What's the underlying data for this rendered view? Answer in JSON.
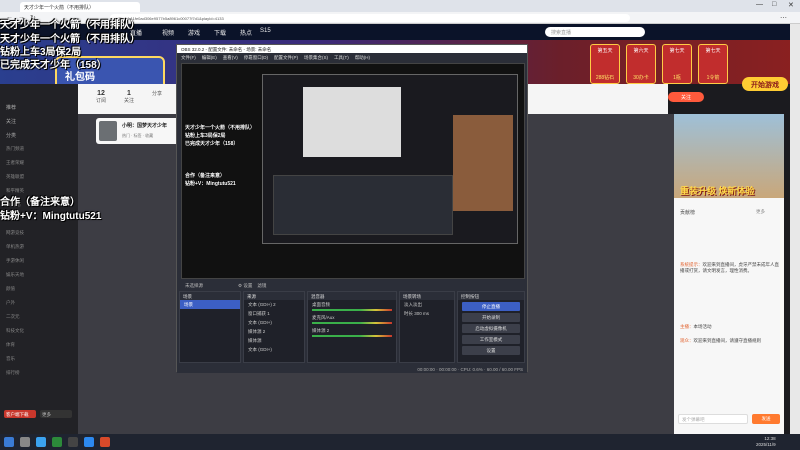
{
  "browser": {
    "tab_title": "天才少年一个火箭（不用排队）",
    "url": "e7beb4-11fe0ad306e9577b5a8961c00077f7d1&playId=4133",
    "window_controls": [
      "—",
      "□",
      "✕"
    ]
  },
  "site": {
    "nav": [
      "直播",
      "视频",
      "游戏",
      "下载",
      "热点",
      "S15"
    ],
    "search_placeholder": "搜索直播",
    "banner_promo": "礼包码",
    "days": [
      {
        "label": "第五天",
        "amount": "288钻石"
      },
      {
        "label": "第六天",
        "amount": "30办卡"
      },
      {
        "label": "第七天",
        "amount": "1瓶"
      },
      {
        "label": "第七天",
        "amount": "1令箭"
      }
    ],
    "play_button": "开始游戏"
  },
  "room": {
    "stats": [
      {
        "value": "12",
        "label": "订阅"
      },
      {
        "value": "1",
        "label": "关注"
      },
      {
        "value": "",
        "label": "分享"
      },
      {
        "value": "",
        "label": "消息"
      }
    ],
    "follow_label": "关注",
    "anchor_name": "小明：国梦天才少年",
    "anchor_tags": "热门 · 标签 · 收藏"
  },
  "sidebar": {
    "items": [
      "推荐",
      "关注",
      "分类",
      "热门频道",
      "王者荣耀",
      "英雄联盟",
      "和平精英",
      "CF手游",
      "原神",
      "网游竞技",
      "单机热游",
      "手游休闲",
      "娱乐天地",
      "颜值",
      "户外",
      "二次元",
      "科技文化",
      "体育",
      "音乐",
      "排行榜"
    ],
    "footer_btn1": "客户端下载",
    "footer_btn2": "更多"
  },
  "overlay": {
    "line1": "天才少年一个火箭（不用排队）",
    "line2": "钻粉上车3局保2局",
    "line3": "已完成天才少年（158）",
    "line4": "合作（备注来意）",
    "line5": "钻粉+V：Mingtutu521"
  },
  "obs": {
    "title": "OBS 32.0.2 - 配置文件: 未命名 - 场景: 未命名",
    "menu": [
      "文件(F)",
      "编辑(E)",
      "查看(V)",
      "停靠窗口(D)",
      "配置文件(P)",
      "场景集合(S)",
      "工具(T)",
      "帮助(H)"
    ],
    "toolbar_items": [
      "未选择源",
      "设置",
      "滤镜"
    ],
    "docks": {
      "scenes": {
        "title": "场景",
        "items": [
          "场景"
        ]
      },
      "sources": {
        "title": "来源",
        "items": [
          "文本 (GDI+) 2",
          "窗口捕获 1",
          "文本 (GDI+)",
          "媒体源 2",
          "媒体源",
          "文本 (GDI+)"
        ]
      },
      "mixer": {
        "title": "混音器",
        "items": [
          "桌面音频",
          "麦克风/Aux",
          "媒体源 2"
        ]
      },
      "transitions": {
        "title": "场景转场",
        "items": [
          "淡入淡出",
          "时长 300 ms"
        ]
      },
      "controls": {
        "title": "控制按钮",
        "buttons": [
          "停止直播",
          "开始录制",
          "启动虚拟摄像机",
          "工作室模式",
          "设置"
        ]
      }
    },
    "status": "00:00:00 · 00:00:00 · CPU: 0.6% · 60.00 / 60.00 FPS"
  },
  "right": {
    "game_ad": "重装升级 焕新体验",
    "rank_title": "贡献榜",
    "rank_link": "更多",
    "chat": [
      {
        "user": "系统提示：",
        "text": "欢迎来到直播间，虎牙严禁未成年人直播或打赏，请文明发言，理性消费。"
      },
      {
        "user": "主播：",
        "text": "本场活动"
      },
      {
        "user": "观众：",
        "text": "欢迎来到直播间，请遵守直播规则"
      }
    ],
    "chat_placeholder": "发个弹幕吧",
    "send_label": "发送"
  },
  "taskbar": {
    "time": "12:38",
    "date": "2025/11/9"
  }
}
